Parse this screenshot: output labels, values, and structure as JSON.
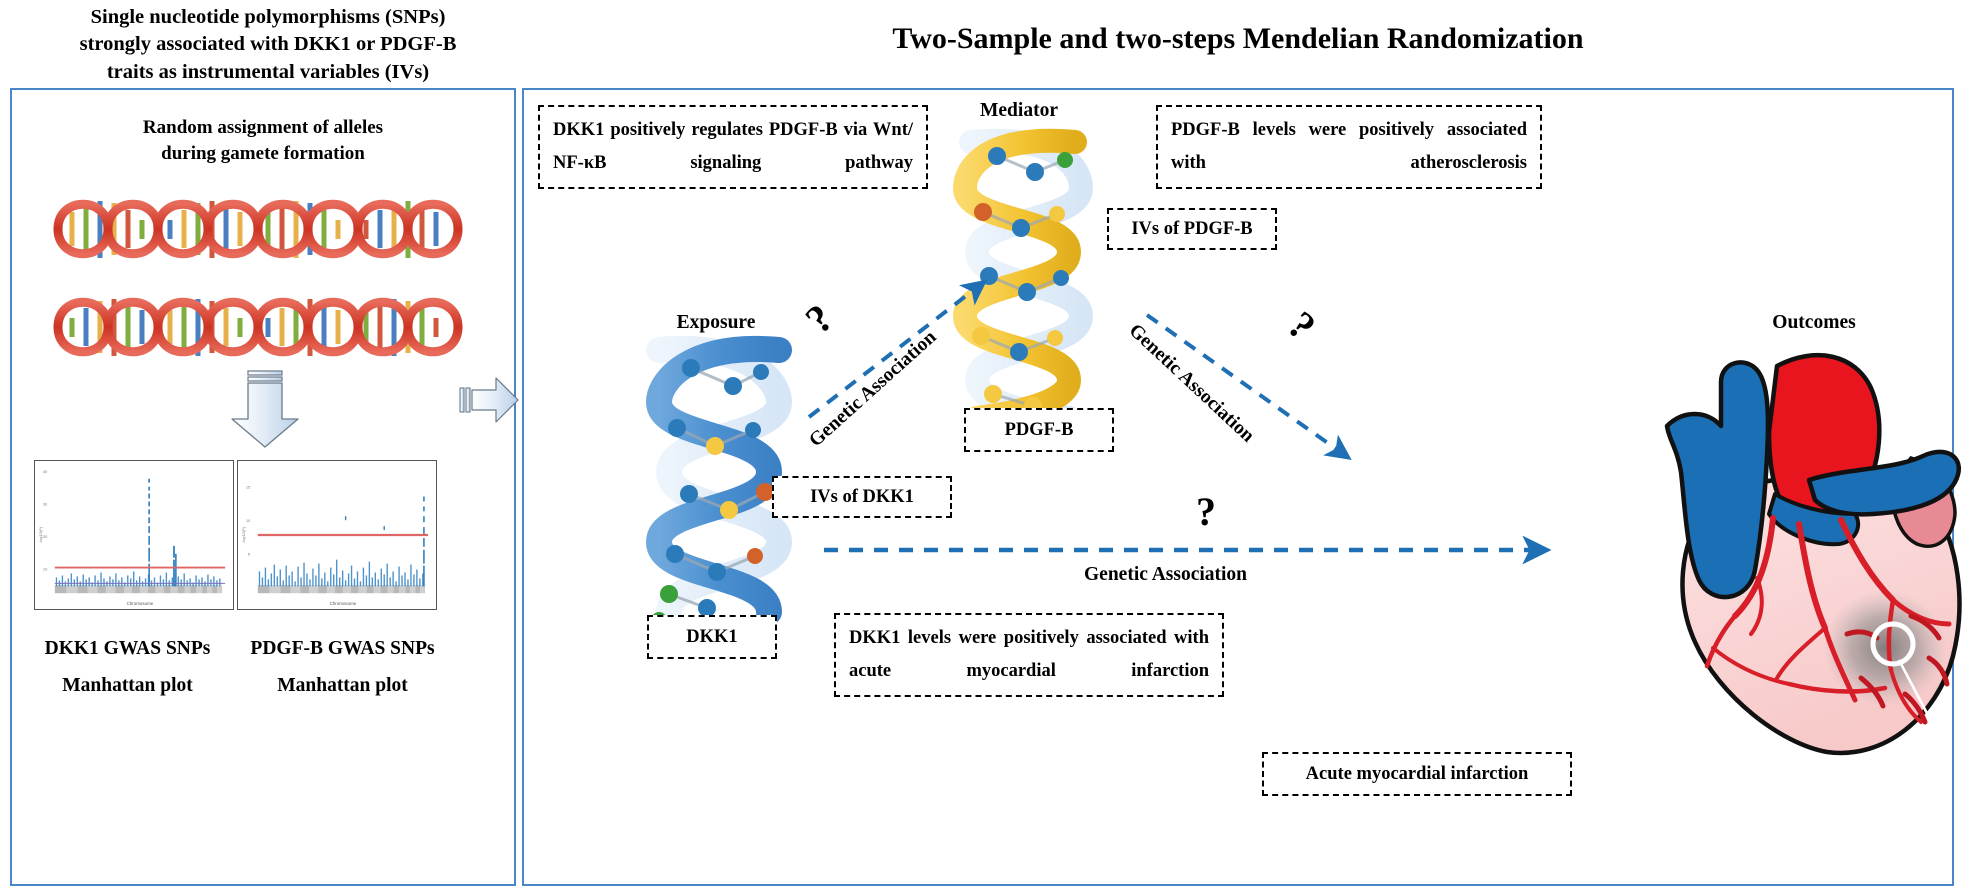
{
  "left": {
    "header": "Single nucleotide polymorphisms (SNPs)\nstrongly associated with DKK1 or PDGF-B\ntraits as instrumental variables (IVs)",
    "subtitle": "Random assignment of alleles\nduring gamete formation",
    "plots": [
      {
        "caption_line1": "DKK1 GWAS SNPs",
        "caption_line2": "Manhattan plot",
        "ylabel": "-log10(P)",
        "xlabel": "Chromosome"
      },
      {
        "caption_line1": "PDGF-B GWAS SNPs",
        "caption_line2": "Manhattan plot",
        "ylabel": "-log10(P)",
        "xlabel": "Chromosome"
      }
    ]
  },
  "title": "Two-Sample and two-steps Mendelian Randomization",
  "annotations": {
    "dkk1_regulates_pdgfb": "DKK1 positively regulates PDGF-B via Wnt/ NF-κB signaling pathway",
    "pdgfb_atherosclerosis": "PDGF-B levels were positively associated with atherosclerosis",
    "dkk1_ami": "DKK1 levels were positively associated with acute myocardial infarction"
  },
  "nodes": {
    "exposure_label": "Exposure",
    "exposure_name": "DKK1",
    "mediator_label": "Mediator",
    "mediator_name": "PDGF-B",
    "outcome_label": "Outcomes",
    "outcome_callout": "Acute myocardial infarction"
  },
  "ivs": {
    "dkk1": "IVs of DKK1",
    "pdgfb": "IVs of PDGF-B"
  },
  "arrows": {
    "exposure_to_mediator": "Genetic Association",
    "mediator_to_outcome": "Genetic Association",
    "exposure_to_outcome": "Genetic Association",
    "question": "?"
  },
  "colors": {
    "panel_border": "#4a87c8",
    "arrow_blue": "#1f6fb4",
    "dna_blue": "#4a8fd0",
    "dna_yellow": "#f2c230",
    "node_blue": "#2b7bba",
    "node_yellow": "#f5c842",
    "node_orange": "#d2622a",
    "node_green": "#3aa03a",
    "heart_red": "#e8141e",
    "heart_blue": "#1a6fb5",
    "heart_pink": "#fad5d5",
    "coronary_red": "#d81e28",
    "manhattan_point": "#2e7fc1",
    "manhattan_line": "#e06666"
  }
}
